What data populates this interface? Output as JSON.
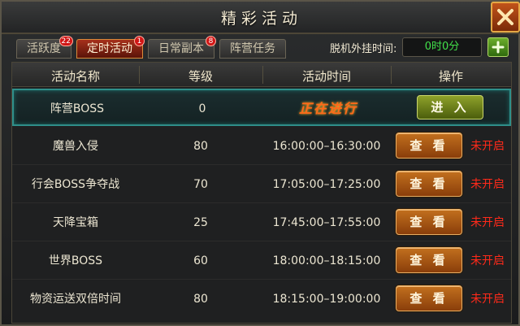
{
  "window": {
    "title": "精彩活动",
    "close_icon": "close-x-icon"
  },
  "tabs": [
    {
      "label": "活跃度",
      "badge": "22",
      "active": false
    },
    {
      "label": "定时活动",
      "badge": "1",
      "active": true
    },
    {
      "label": "日常副本",
      "badge": "8",
      "active": false
    },
    {
      "label": "阵营任务",
      "badge": "",
      "active": false
    }
  ],
  "offline": {
    "label": "脱机外挂时间:",
    "value": "0时0分",
    "add_icon": "plus-icon"
  },
  "table": {
    "headers": {
      "name": "活动名称",
      "level": "等级",
      "time": "活动时间",
      "action": "操作"
    },
    "rows": [
      {
        "name": "阵营BOSS",
        "level": "0",
        "time": "正在进行",
        "button": "进 入",
        "status": ""
      },
      {
        "name": "魔兽入侵",
        "level": "80",
        "time": "16:00:00–16:30:00",
        "button": "查 看",
        "status": "未开启"
      },
      {
        "name": "行会BOSS争夺战",
        "level": "70",
        "time": "17:05:00–17:25:00",
        "button": "查 看",
        "status": "未开启"
      },
      {
        "name": "天降宝箱",
        "level": "25",
        "time": "17:45:00–17:55:00",
        "button": "查 看",
        "status": "未开启"
      },
      {
        "name": "世界BOSS",
        "level": "60",
        "time": "18:00:00–18:15:00",
        "button": "查 看",
        "status": "未开启"
      },
      {
        "name": "物资运送双倍时间",
        "level": "80",
        "time": "18:15:00–19:00:00",
        "button": "查 看",
        "status": "未开启"
      }
    ]
  },
  "colors": {
    "accent_orange": "#c2701e",
    "status_red": "#ff2a1a",
    "highlight_teal": "#2e8f8a",
    "timer_green": "#42e04a"
  }
}
